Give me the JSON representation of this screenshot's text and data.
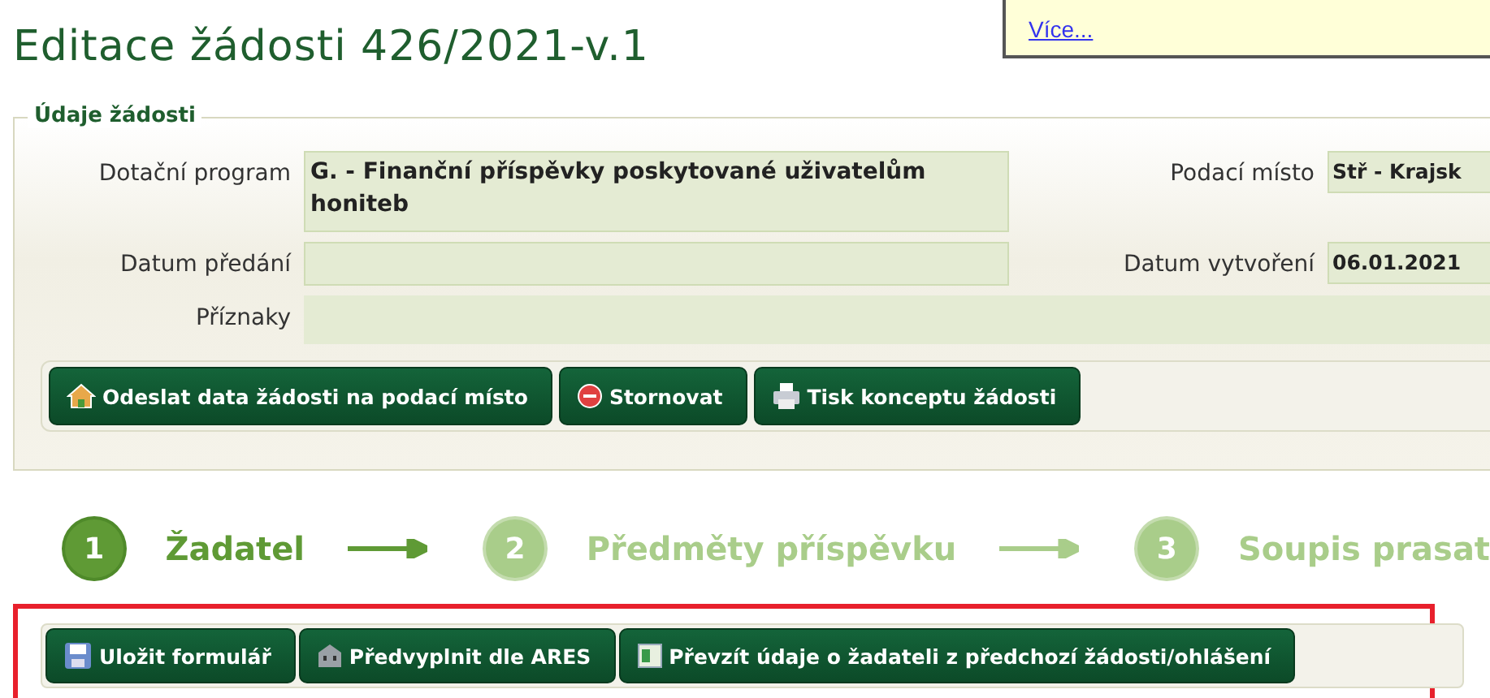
{
  "page_title": "Editace žádosti 426/2021-v.1",
  "notice": {
    "link": "Více..."
  },
  "request_details": {
    "legend": "Údaje žádosti",
    "fields": [
      {
        "label": "Dotační program",
        "value": "G. - Finanční příspěvky poskytované uživatelům honiteb"
      },
      {
        "label": "Podací místo",
        "value": "Stř - Krajsk"
      },
      {
        "label": "Datum předání"
      },
      {
        "label": "Datum vytvoření",
        "value": "06.01.2021"
      },
      {
        "label": "Příznaky"
      }
    ],
    "buttons": [
      {
        "label": "Odeslat data žádosti na podací místo",
        "kind": "house"
      },
      {
        "label": "Stornovat",
        "kind": "cancel"
      },
      {
        "label": "Tisk konceptu žádosti",
        "kind": "print"
      }
    ]
  },
  "steps": [
    {
      "number": "1",
      "label": "Žadatel",
      "selected": true
    },
    {
      "number": "2",
      "label": "Předměty příspěvku",
      "selected": false
    },
    {
      "number": "3",
      "label": "Soupis prasat",
      "selected": false
    }
  ],
  "form_toolbar": [
    {
      "label": "Uložit formulář",
      "kind": "save"
    },
    {
      "label": "Předvyplnit dle ARES",
      "kind": "building"
    },
    {
      "label": "Převzít údaje o žadateli z předchozí žádosti/ohlášení",
      "kind": "import"
    }
  ]
}
